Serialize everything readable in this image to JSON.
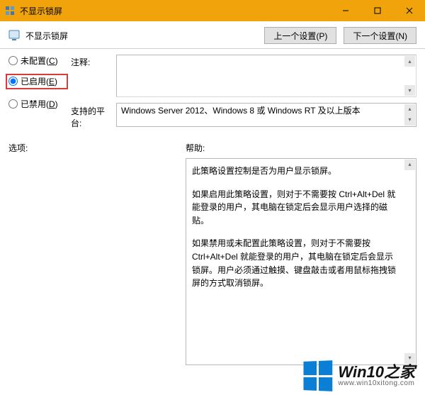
{
  "window": {
    "title": "不显示锁屏"
  },
  "header": {
    "page_title": "不显示锁屏",
    "prev_button": "上一个设置(P)",
    "next_button": "下一个设置(N)"
  },
  "radios": {
    "not_configured": "未配置(",
    "not_configured_mn": "C",
    "not_configured_after": ")",
    "enabled": "已启用(",
    "enabled_mn": "E",
    "enabled_after": ")",
    "disabled": "已禁用(",
    "disabled_mn": "D",
    "disabled_after": ")"
  },
  "labels": {
    "notes": "注释:",
    "platform": "支持的平台:",
    "options": "选项:",
    "help": "帮助:"
  },
  "platform_text": "Windows Server 2012、Windows 8 或 Windows RT 及以上版本",
  "help": {
    "p1": "此策略设置控制是否为用户显示锁屏。",
    "p2": "如果启用此策略设置，则对于不需要按 Ctrl+Alt+Del 就能登录的用户，其电脑在锁定后会显示用户选择的磁贴。",
    "p3": "如果禁用或未配置此策略设置，则对于不需要按 Ctrl+Alt+Del 就能登录的用户，其电脑在锁定后会显示锁屏。用户必须通过触摸、键盘敲击或者用鼠标拖拽锁屏的方式取消锁屏。"
  },
  "watermark": {
    "line1": "Win10之家",
    "line2": "www.win10xitong.com"
  },
  "scroll": {
    "up": "▴",
    "down": "▾"
  }
}
